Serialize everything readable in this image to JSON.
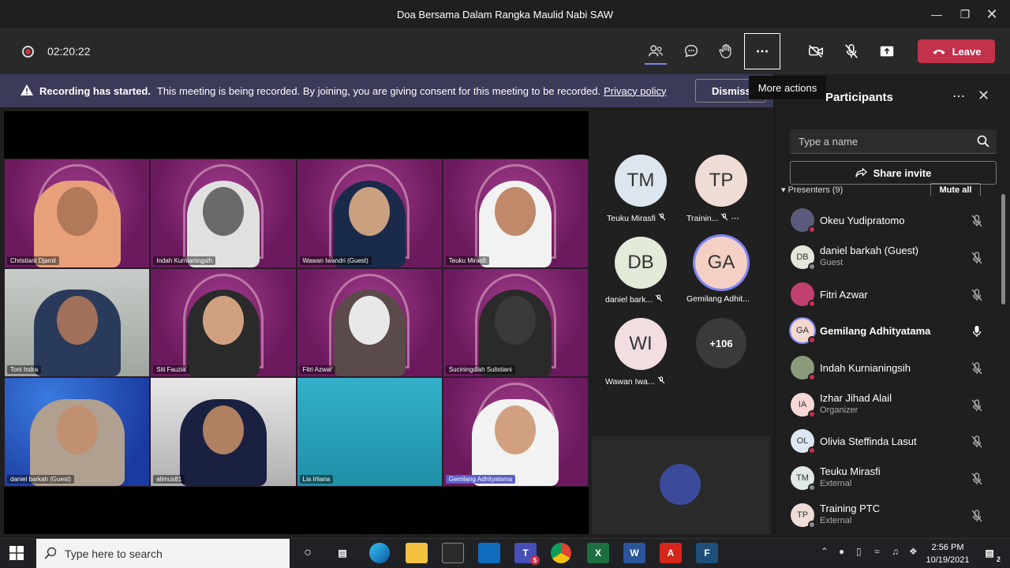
{
  "window": {
    "title": "Doa Bersama Dalam Rangka Maulid Nabi SAW"
  },
  "toolbar": {
    "timer": "02:20:22",
    "leave_label": "Leave",
    "more_tooltip": "More actions"
  },
  "banner": {
    "bold": "Recording has started.",
    "text": "This meeting is being recorded. By joining, you are giving consent for this meeting to be recorded.",
    "link": "Privacy policy",
    "dismiss": "Dismiss"
  },
  "grid": [
    "Christiani Djamil",
    "Indah Kurnianingsih",
    "Wawan Iwandri (Guest)",
    "Teuku Mirasfi",
    "Toni Indra",
    "Siti Fauzia",
    "Fitri Azwar",
    "Suciningdiah Sulistiani",
    "daniel barkah (Guest)",
    "alimus81",
    "Lia Irliana",
    "Gemilang Adhityatama"
  ],
  "tiles": {
    "tm": {
      "initials": "TM",
      "label": "Teuku Mirasfi"
    },
    "tp": {
      "initials": "TP",
      "label": "Trainin..."
    },
    "db": {
      "initials": "DB",
      "label": "daniel bark..."
    },
    "ga": {
      "initials": "GA",
      "label": "Gemilang Adhit..."
    },
    "wi": {
      "initials": "WI",
      "label": "Wawan Iwa..."
    },
    "more": "+106"
  },
  "panel": {
    "title": "Participants",
    "search_placeholder": "Type a name",
    "share_invite": "Share invite",
    "section": "Presenters (9)",
    "mute_all": "Mute all",
    "participants": [
      {
        "name": "Okeu Yudipratomo",
        "role": "",
        "initials": ""
      },
      {
        "name": "daniel barkah (Guest)",
        "role": "Guest",
        "initials": "DB"
      },
      {
        "name": "Fitri Azwar",
        "role": "",
        "initials": ""
      },
      {
        "name": "Gemilang Adhityatama",
        "role": "",
        "initials": "GA"
      },
      {
        "name": "Indah Kurnianingsih",
        "role": "",
        "initials": ""
      },
      {
        "name": "Izhar Jihad Alail",
        "role": "Organizer",
        "initials": "IA"
      },
      {
        "name": "Olivia Steffinda Lasut",
        "role": "",
        "initials": "OL"
      },
      {
        "name": "Teuku Mirasfi",
        "role": "External",
        "initials": "TM"
      },
      {
        "name": "Training PTC",
        "role": "External",
        "initials": "TP"
      }
    ]
  },
  "taskbar": {
    "search_placeholder": "Type here to search",
    "teams_badge": "5",
    "time": "2:56 PM",
    "date": "10/19/2021",
    "notif_count": "2"
  }
}
